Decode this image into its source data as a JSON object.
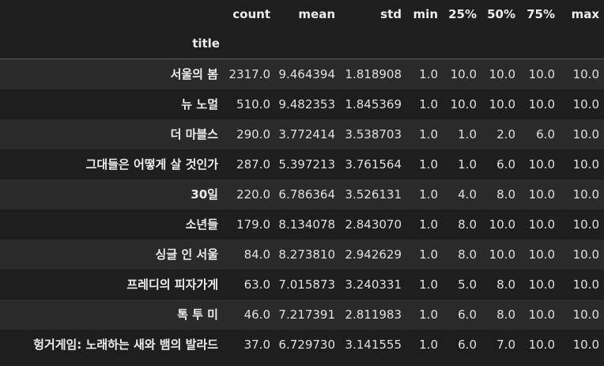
{
  "table": {
    "columns": [
      "count",
      "mean",
      "std",
      "min",
      "25%",
      "50%",
      "75%",
      "max"
    ],
    "index_name": "title",
    "rows": [
      {
        "title": "서울의 봄",
        "values": [
          "2317.0",
          "9.464394",
          "1.818908",
          "1.0",
          "10.0",
          "10.0",
          "10.0",
          "10.0"
        ]
      },
      {
        "title": "뉴 노멀",
        "values": [
          "510.0",
          "9.482353",
          "1.845369",
          "1.0",
          "10.0",
          "10.0",
          "10.0",
          "10.0"
        ]
      },
      {
        "title": "더 마블스",
        "values": [
          "290.0",
          "3.772414",
          "3.538703",
          "1.0",
          "1.0",
          "2.0",
          "6.0",
          "10.0"
        ]
      },
      {
        "title": "그대들은 어떻게 살 것인가",
        "values": [
          "287.0",
          "5.397213",
          "3.761564",
          "1.0",
          "1.0",
          "6.0",
          "10.0",
          "10.0"
        ]
      },
      {
        "title": "30일",
        "values": [
          "220.0",
          "6.786364",
          "3.526131",
          "1.0",
          "4.0",
          "8.0",
          "10.0",
          "10.0"
        ]
      },
      {
        "title": "소년들",
        "values": [
          "179.0",
          "8.134078",
          "2.843070",
          "1.0",
          "8.0",
          "10.0",
          "10.0",
          "10.0"
        ]
      },
      {
        "title": "싱글 인 서울",
        "values": [
          "84.0",
          "8.273810",
          "2.942629",
          "1.0",
          "8.0",
          "10.0",
          "10.0",
          "10.0"
        ]
      },
      {
        "title": "프레디의 피자가게",
        "values": [
          "63.0",
          "7.015873",
          "3.240331",
          "1.0",
          "5.0",
          "8.0",
          "10.0",
          "10.0"
        ]
      },
      {
        "title": "톡 투 미",
        "values": [
          "46.0",
          "7.217391",
          "2.811983",
          "1.0",
          "6.0",
          "8.0",
          "10.0",
          "10.0"
        ]
      },
      {
        "title": "헝거게임: 노래하는 새와 뱀의 발라드",
        "values": [
          "37.0",
          "6.729730",
          "3.141555",
          "1.0",
          "6.0",
          "7.0",
          "10.0",
          "10.0"
        ]
      }
    ]
  }
}
